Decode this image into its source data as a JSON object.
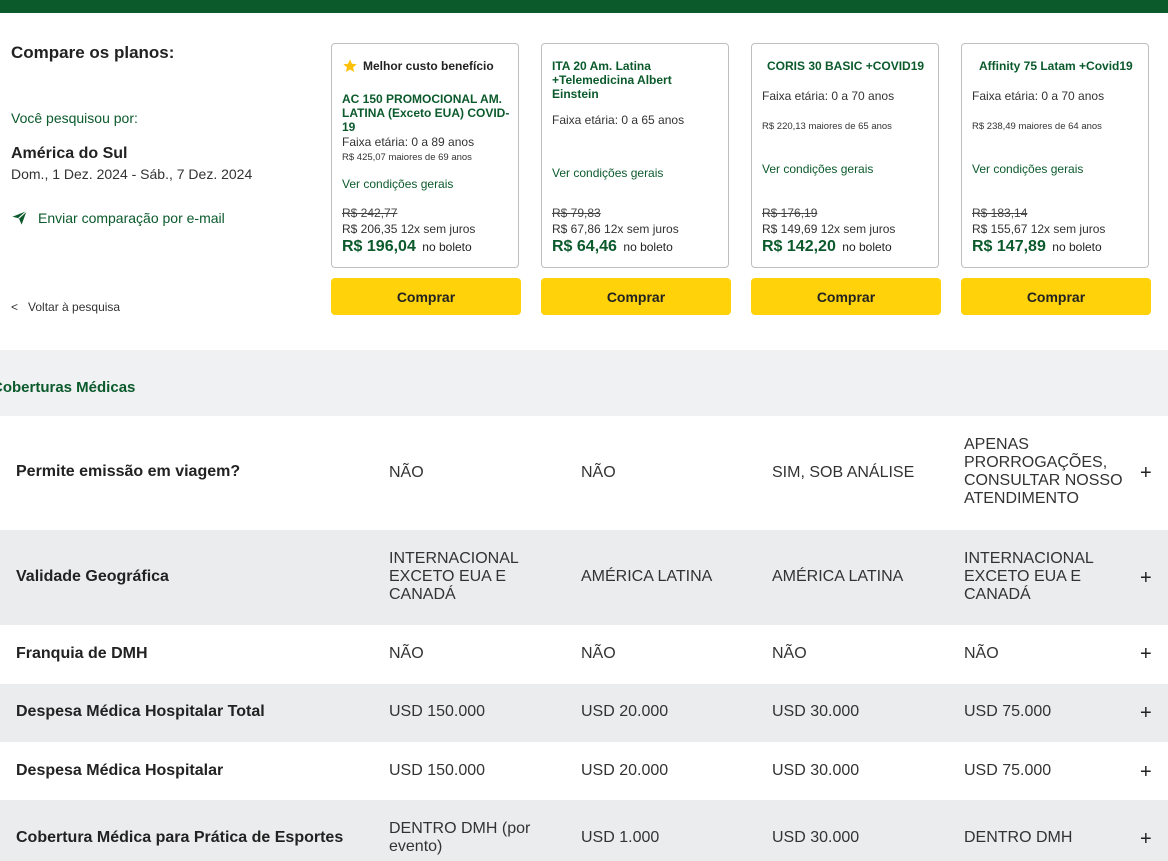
{
  "sidebar": {
    "title": "Compare os planos:",
    "searched_label": "Você pesquisou por:",
    "destination": "América do Sul",
    "dates": "Dom., 1 Dez. 2024 - Sáb., 7 Dez. 2024",
    "email_link": "Enviar comparação por e-mail",
    "back_chevron": "<",
    "back_link": "Voltar à pesquisa"
  },
  "best_badge": "Melhor custo benefício",
  "plans": [
    {
      "name": "AC 150 PROMOCIONAL AM. LATINA (Exceto EUA) COVID-19",
      "faixa": "Faixa etária: 0 a 89 anos",
      "maiores": "R$ 425,07 maiores de 69 anos",
      "conditions": "Ver condições gerais",
      "old_price": "R$ 242,77",
      "installment": "R$ 206,35 12x sem juros",
      "price": "R$ 196,04",
      "boleto": "no boleto",
      "buy": "Comprar"
    },
    {
      "name": "ITA 20 Am. Latina +Telemedicina Albert Einstein",
      "faixa": "Faixa etária: 0 a 65 anos",
      "maiores": "",
      "conditions": "Ver condições gerais",
      "old_price": "R$ 79,83",
      "installment": "R$ 67,86 12x sem juros",
      "price": "R$ 64,46",
      "boleto": "no boleto",
      "buy": "Comprar"
    },
    {
      "name": "CORIS 30 BASIC +COVID19",
      "faixa": "Faixa etária: 0 a 70 anos",
      "maiores": "R$ 220,13 maiores de 65 anos",
      "conditions": "Ver condições gerais",
      "old_price": "R$ 176,19",
      "installment": "R$ 149,69 12x sem juros",
      "price": "R$ 142,20",
      "boleto": "no boleto",
      "buy": "Comprar"
    },
    {
      "name": "Affinity 75 Latam +Covid19",
      "faixa": "Faixa etária: 0 a 70 anos",
      "maiores": "R$ 238,49 maiores de 64 anos",
      "conditions": "Ver condições gerais",
      "old_price": "R$ 183,14",
      "installment": "R$ 155,67 12x sem juros",
      "price": "R$ 147,89",
      "boleto": "no boleto",
      "buy": "Comprar"
    }
  ],
  "section": {
    "title": "Coberturas Médicas"
  },
  "expand_symbol": "+",
  "rows": [
    {
      "label": "Permite emissão em viagem?",
      "values": [
        "NÃO",
        "NÃO",
        "SIM, SOB ANÁLISE",
        "APENAS PRORROGAÇÕES, CONSULTAR NOSSO ATENDIMENTO"
      ]
    },
    {
      "label": "Validade Geográfica",
      "values": [
        "INTERNACIONAL EXCETO EUA E CANADÁ",
        "AMÉRICA LATINA",
        "AMÉRICA LATINA",
        "INTERNACIONAL EXCETO EUA E CANADÁ"
      ]
    },
    {
      "label": "Franquia de DMH",
      "values": [
        "NÃO",
        "NÃO",
        "NÃO",
        "NÃO"
      ]
    },
    {
      "label": "Despesa Médica Hospitalar Total",
      "values": [
        "USD 150.000",
        "USD 20.000",
        "USD 30.000",
        "USD 75.000"
      ]
    },
    {
      "label": "Despesa Médica Hospitalar",
      "values": [
        "USD 150.000",
        "USD 20.000",
        "USD 30.000",
        "USD 75.000"
      ]
    },
    {
      "label": "Cobertura Médica para Prática de Esportes",
      "values": [
        "DENTRO DMH (por evento)",
        "USD 1.000",
        "USD 30.000",
        "DENTRO DMH"
      ]
    }
  ],
  "colors": {
    "brand_green": "#0b5a2c",
    "buy_yellow": "#ffd20a",
    "row_alt": "#ebeced"
  },
  "icons": {
    "best": "star-icon",
    "email": "paper-plane-icon",
    "expand": "plus-icon"
  }
}
